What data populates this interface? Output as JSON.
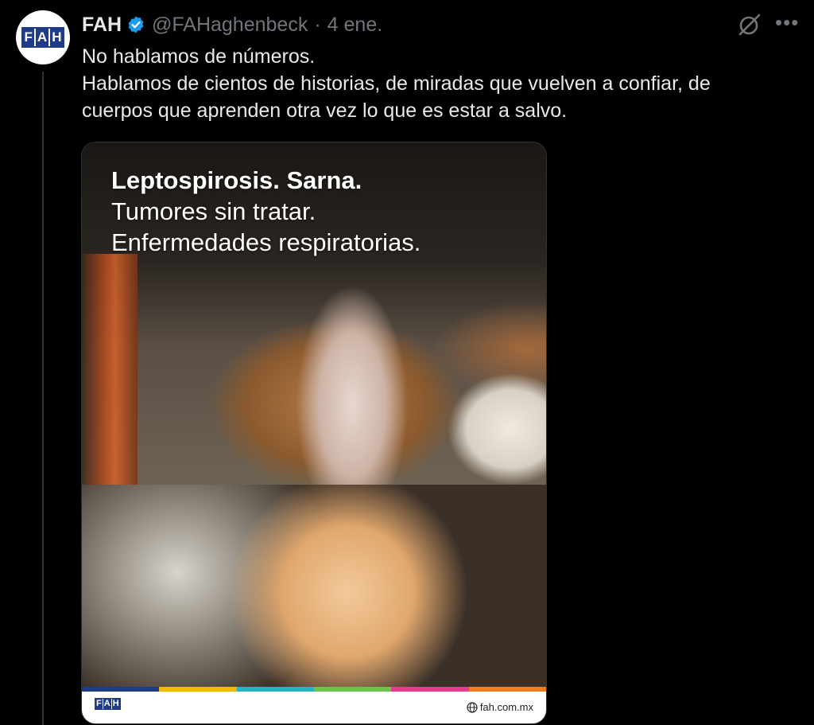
{
  "author": {
    "display_name": "FAH",
    "handle": "@FAHaghenbeck",
    "separator": "·",
    "date": "4 ene.",
    "avatar_letters": [
      "F",
      "A",
      "H"
    ]
  },
  "tweet": {
    "lines": [
      "No hablamos de números.",
      "Hablamos de cientos de historias, de miradas que vuelven a confiar, de cuerpos que aprenden otra vez lo que es estar a salvo."
    ]
  },
  "media": {
    "overlay_lines": [
      "Leptospirosis. Sarna.",
      "Tumores sin tratar.",
      "Enfermedades respiratorias."
    ],
    "footer_logo_letters": [
      "F",
      "A",
      "H"
    ],
    "footer_url": "fah.com.mx",
    "stripe_colors": [
      "#1f3c88",
      "#f2b705",
      "#27b3c2",
      "#6cc24a",
      "#e63c8f",
      "#ef7d22"
    ]
  },
  "icons": {
    "verified": "verified-badge-icon",
    "grok": "grok-icon",
    "more": "more-icon",
    "globe": "globe-icon"
  },
  "colors": {
    "background": "#000000",
    "text_primary": "#e7e9ea",
    "text_secondary": "#71767b",
    "verified_blue": "#1d9bf0",
    "brand_blue": "#1f3c88"
  }
}
